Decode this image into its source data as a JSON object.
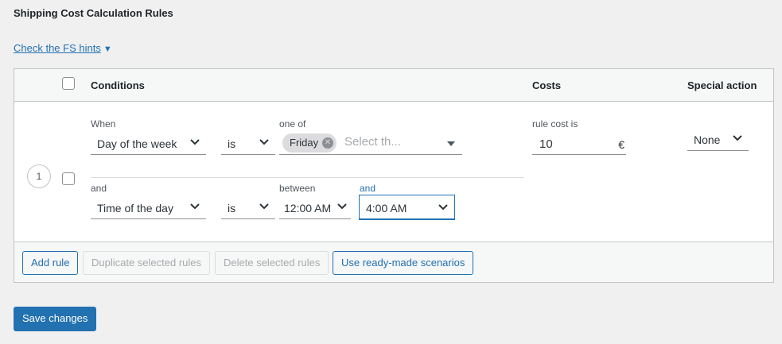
{
  "section_title": "Shipping Cost Calculation Rules",
  "hints_link": {
    "label": "Check the FS hints",
    "arrow": "▼"
  },
  "table": {
    "headers": {
      "conditions": "Conditions",
      "costs": "Costs",
      "special_action": "Special action"
    },
    "rows": [
      {
        "number": "1",
        "conditions": [
          {
            "prefix_label": "When",
            "field": "Day of the week",
            "operator": "is",
            "value_label": "one of",
            "chips": [
              "Friday"
            ],
            "placeholder": "Select th..."
          },
          {
            "prefix_label": "and",
            "field": "Time of the day",
            "operator": "is",
            "value_label": "between",
            "value_from": "12:00 AM",
            "and_label": "and",
            "value_to": "4:00 AM"
          }
        ],
        "cost_label": "rule cost is",
        "cost_value": "10",
        "currency": "€",
        "special_action": "None"
      }
    ]
  },
  "footer_buttons": {
    "add_rule": "Add rule",
    "duplicate": "Duplicate selected rules",
    "delete": "Delete selected rules",
    "scenarios": "Use ready-made scenarios"
  },
  "save_button": "Save changes",
  "colors": {
    "accent": "#2271b1",
    "background": "#f0f0f1",
    "border": "#c3c4c7"
  }
}
